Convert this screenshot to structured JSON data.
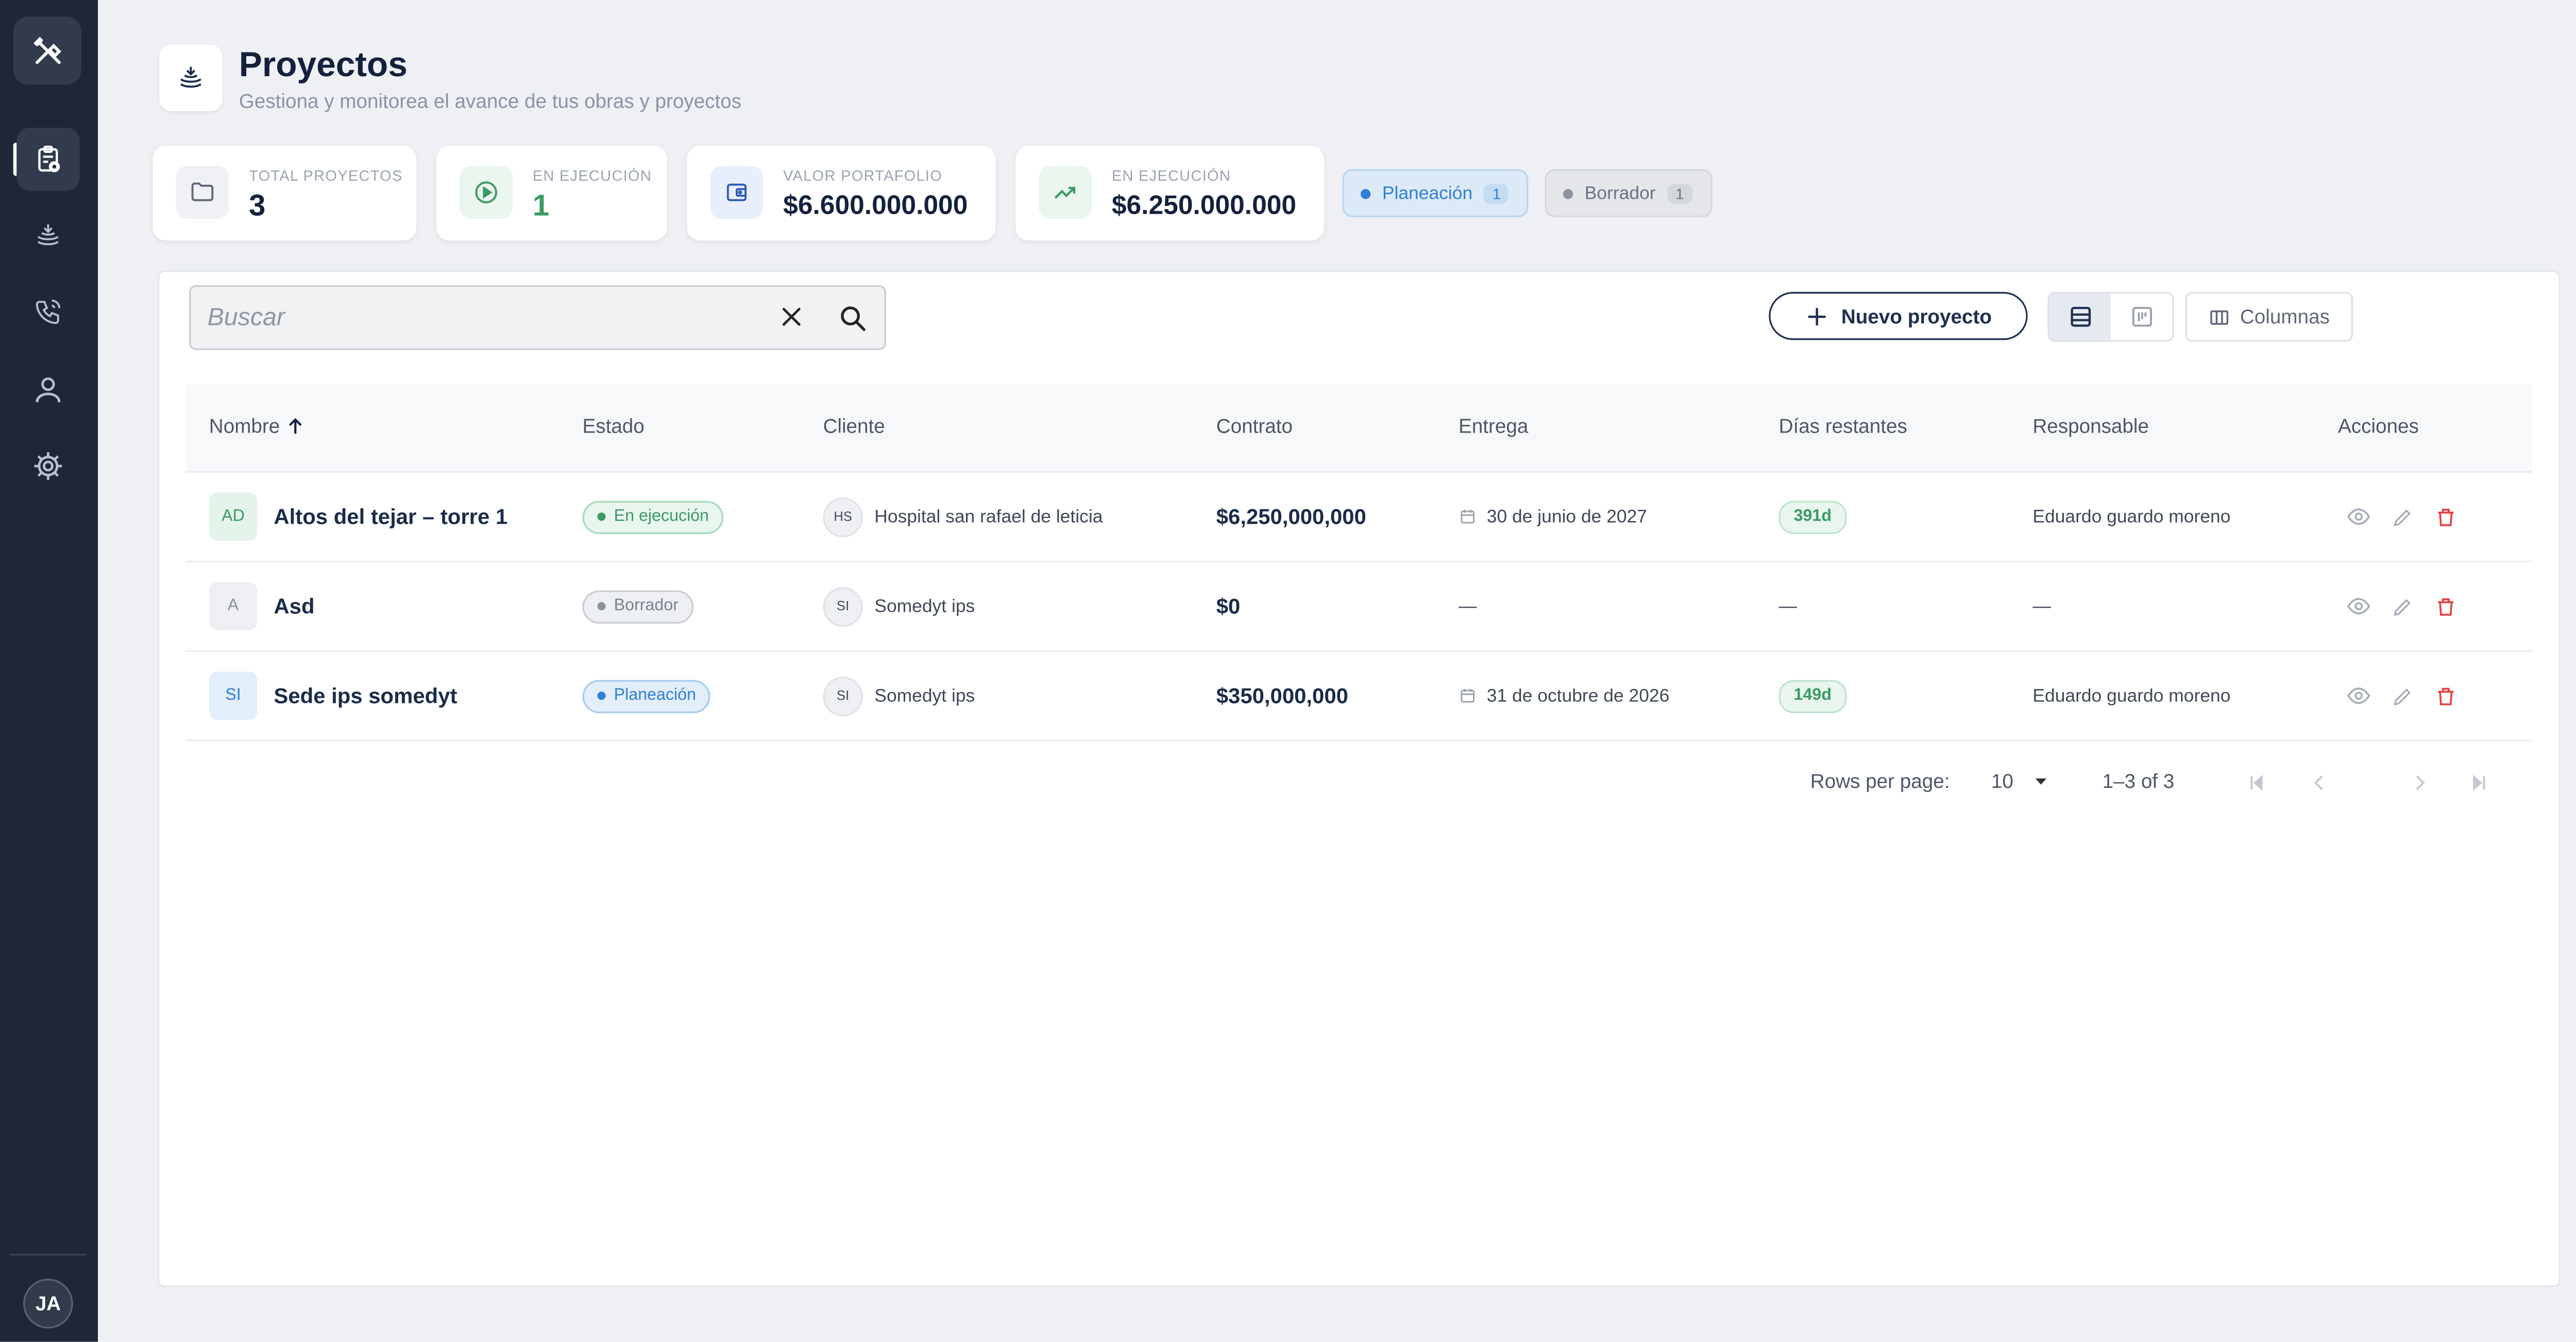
{
  "sidebar": {
    "logo_icon": "tools-icon",
    "items": [
      {
        "name": "projects",
        "icon": "clipboard-add-icon",
        "active": true
      },
      {
        "name": "works",
        "icon": "layers-icon",
        "active": false
      },
      {
        "name": "contacts",
        "icon": "phone-icon",
        "active": false
      },
      {
        "name": "users",
        "icon": "user-icon",
        "active": false
      },
      {
        "name": "settings",
        "icon": "gear-icon",
        "active": false
      }
    ],
    "avatar": "JA"
  },
  "header": {
    "title": "Proyectos",
    "subtitle": "Gestiona y monitorea el avance de tus obras y proyectos"
  },
  "stats": [
    {
      "label": "Total proyectos",
      "value": "3",
      "icon": "folder-icon"
    },
    {
      "label": "En ejecución",
      "value": "1",
      "icon": "play-icon"
    },
    {
      "label": "Valor portafolio",
      "value": "$6.600.000.000",
      "icon": "wallet-icon"
    },
    {
      "label": "En ejecución",
      "value": "$6.250.000.000",
      "icon": "trend-up-icon"
    }
  ],
  "chips": [
    {
      "label": "Planeación",
      "count": "1"
    },
    {
      "label": "Borrador",
      "count": "1"
    }
  ],
  "toolbar": {
    "search_placeholder": "Buscar",
    "new_label": "Nuevo proyecto",
    "columns_label": "Columnas"
  },
  "table": {
    "columns": [
      "Nombre",
      "Estado",
      "Cliente",
      "Contrato",
      "Entrega",
      "Días restantes",
      "Responsable",
      "Acciones"
    ],
    "rows": [
      {
        "initials": "AD",
        "name": "Altos del tejar – torre 1",
        "status": "En ejecución",
        "client_initials": "HS",
        "client": "Hospital san rafael de leticia",
        "contract": "$6,250,000,000",
        "delivery": "30 de junio de 2027",
        "days": "391d",
        "owner": "Eduardo guardo moreno"
      },
      {
        "initials": "A",
        "name": "Asd",
        "status": "Borrador",
        "client_initials": "SI",
        "client": "Somedyt ips",
        "contract": "$0",
        "delivery": "—",
        "days": "—",
        "owner": "—"
      },
      {
        "initials": "SI",
        "name": "Sede ips somedyt",
        "status": "Planeación",
        "client_initials": "SI",
        "client": "Somedyt ips",
        "contract": "$350,000,000",
        "delivery": "31 de octubre de 2026",
        "days": "149d",
        "owner": "Eduardo guardo moreno"
      }
    ]
  },
  "pagination": {
    "rows_label": "Rows per page:",
    "rows_value": "10",
    "range": "1–3 of 3"
  },
  "colors": {
    "sidebar_bg": "#1e2638",
    "green": "#3b9a63",
    "blue": "#2f80d6",
    "red": "#e04545"
  }
}
